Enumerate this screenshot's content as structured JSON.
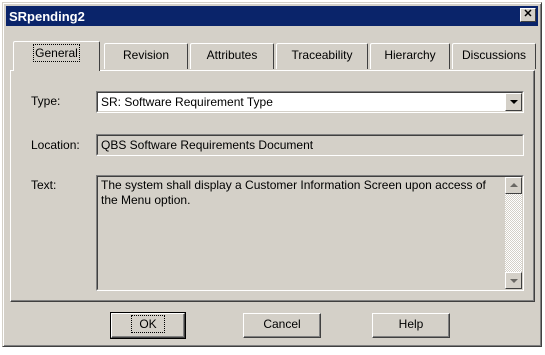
{
  "window": {
    "title": "SRpending2",
    "close_glyph": "✕"
  },
  "tabs": [
    {
      "label": "General",
      "active": true
    },
    {
      "label": "Revision",
      "active": false
    },
    {
      "label": "Attributes",
      "active": false
    },
    {
      "label": "Traceability",
      "active": false
    },
    {
      "label": "Hierarchy",
      "active": false
    },
    {
      "label": "Discussions",
      "active": false
    }
  ],
  "form": {
    "type": {
      "label": "Type:",
      "value": "SR: Software Requirement Type"
    },
    "location": {
      "label": "Location:",
      "value": "QBS Software Requirements Document"
    },
    "text": {
      "label": "Text:",
      "value": "The system shall display a Customer Information Screen upon access of the Menu option."
    }
  },
  "buttons": {
    "ok": "OK",
    "cancel": "Cancel",
    "help": "Help"
  },
  "icons": {
    "close": "close-icon",
    "dropdown": "chevron-down-icon",
    "scroll_up": "scroll-up-icon",
    "scroll_down": "scroll-down-icon"
  },
  "colors": {
    "title_bar": "#0a246a",
    "face": "#d4d0c8"
  }
}
